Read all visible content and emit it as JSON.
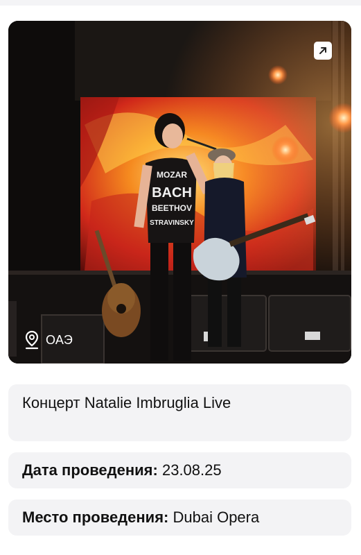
{
  "event": {
    "title": "Концерт Natalie Imbruglia Live",
    "country": "ОАЭ",
    "date_label": "Дата проведения:",
    "date_value": "23.08.25",
    "venue_label": "Место проведения:",
    "venue_value": "Dubai Opera"
  },
  "photo": {
    "shirt_lines": [
      "MOZAR",
      "BACH",
      "BEETHOV",
      "STRAVINSKY"
    ]
  },
  "icons": {
    "open": "arrow-up-right-icon",
    "location": "map-pin-icon"
  },
  "colors": {
    "card_background": "#f3f3f5",
    "text": "#111111",
    "overlay_text": "#ffffff"
  }
}
